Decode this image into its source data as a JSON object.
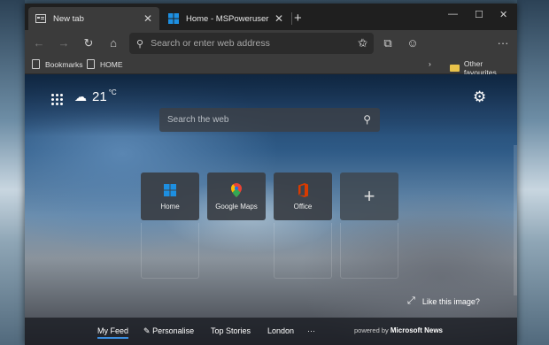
{
  "tabs": [
    {
      "title": "New tab",
      "favicon": "newtab-icon"
    },
    {
      "title": "Home - MSPoweruser",
      "favicon": "windows-logo-icon"
    }
  ],
  "address": {
    "placeholder": "Search or enter web address"
  },
  "favourites": {
    "bookmarks": "Bookmarks",
    "home": "HOME",
    "other": "Other favourites"
  },
  "ntp": {
    "temperature": "21",
    "unit": "°C",
    "search_placeholder": "Search the web",
    "tiles": [
      {
        "label": "Home"
      },
      {
        "label": "Google Maps"
      },
      {
        "label": "Office"
      }
    ],
    "like_image": "Like this image?",
    "news": {
      "my_feed": "My Feed",
      "personalise": "Personalise",
      "top_stories": "Top Stories",
      "london": "London",
      "more": "···",
      "powered_by": "powered by",
      "provider": "Microsoft News"
    }
  },
  "colors": {
    "accent": "#3b8ee0",
    "tab_active": "#3b3b3b",
    "windows_logo": "#1d8fe1",
    "office": "#d83b01"
  }
}
